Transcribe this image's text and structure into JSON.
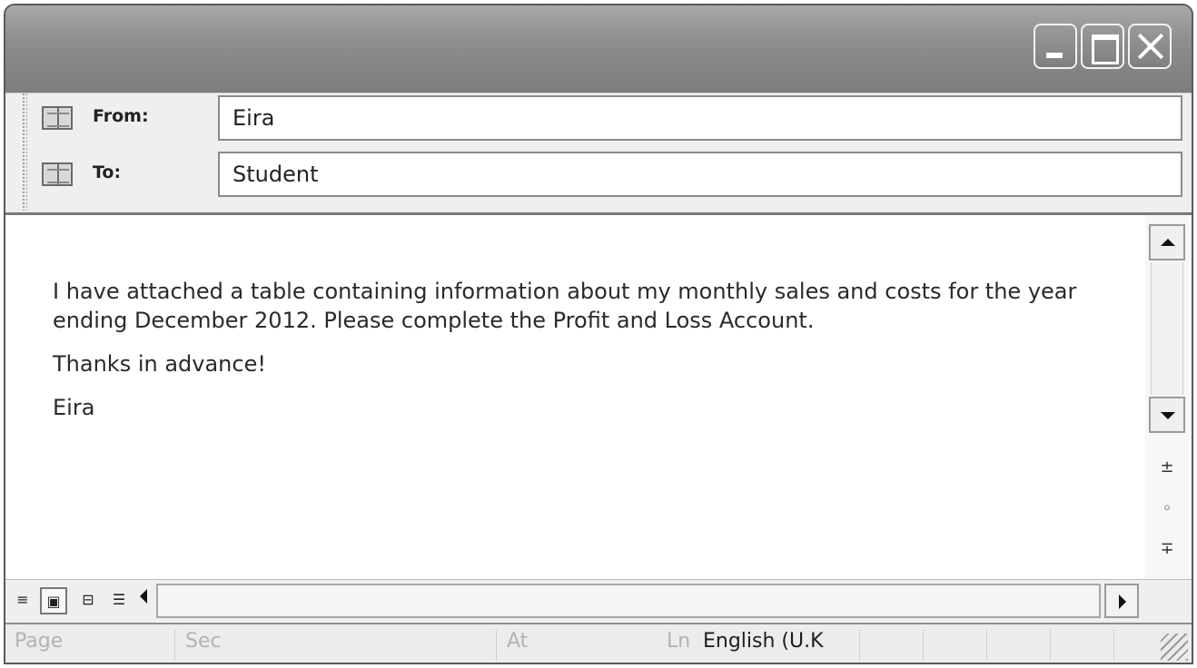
{
  "window": {
    "controls": [
      "minimize-icon",
      "maximize-icon",
      "close-icon"
    ]
  },
  "header": {
    "from_label": "From:",
    "from_value": "Eira",
    "to_label": "To:",
    "to_value": "Student",
    "address_book_icon": "address-book-icon"
  },
  "message": {
    "line1": "I have attached a table containing information about my monthly sales and costs for the year ending December 2012. Please complete the Profit and Loss Account.",
    "line2": "Thanks in advance!",
    "line3": "Eira"
  },
  "scrollbar": {
    "previous_icon": "±",
    "object_icon": "◦",
    "next_icon": "∓"
  },
  "view_buttons": {
    "normal": "≡",
    "web": "▣",
    "print": "⊟",
    "outline": "☰"
  },
  "status": {
    "page": "Page",
    "sec": "Sec",
    "at": "At",
    "ln": "Ln",
    "language": "English (U.K"
  }
}
